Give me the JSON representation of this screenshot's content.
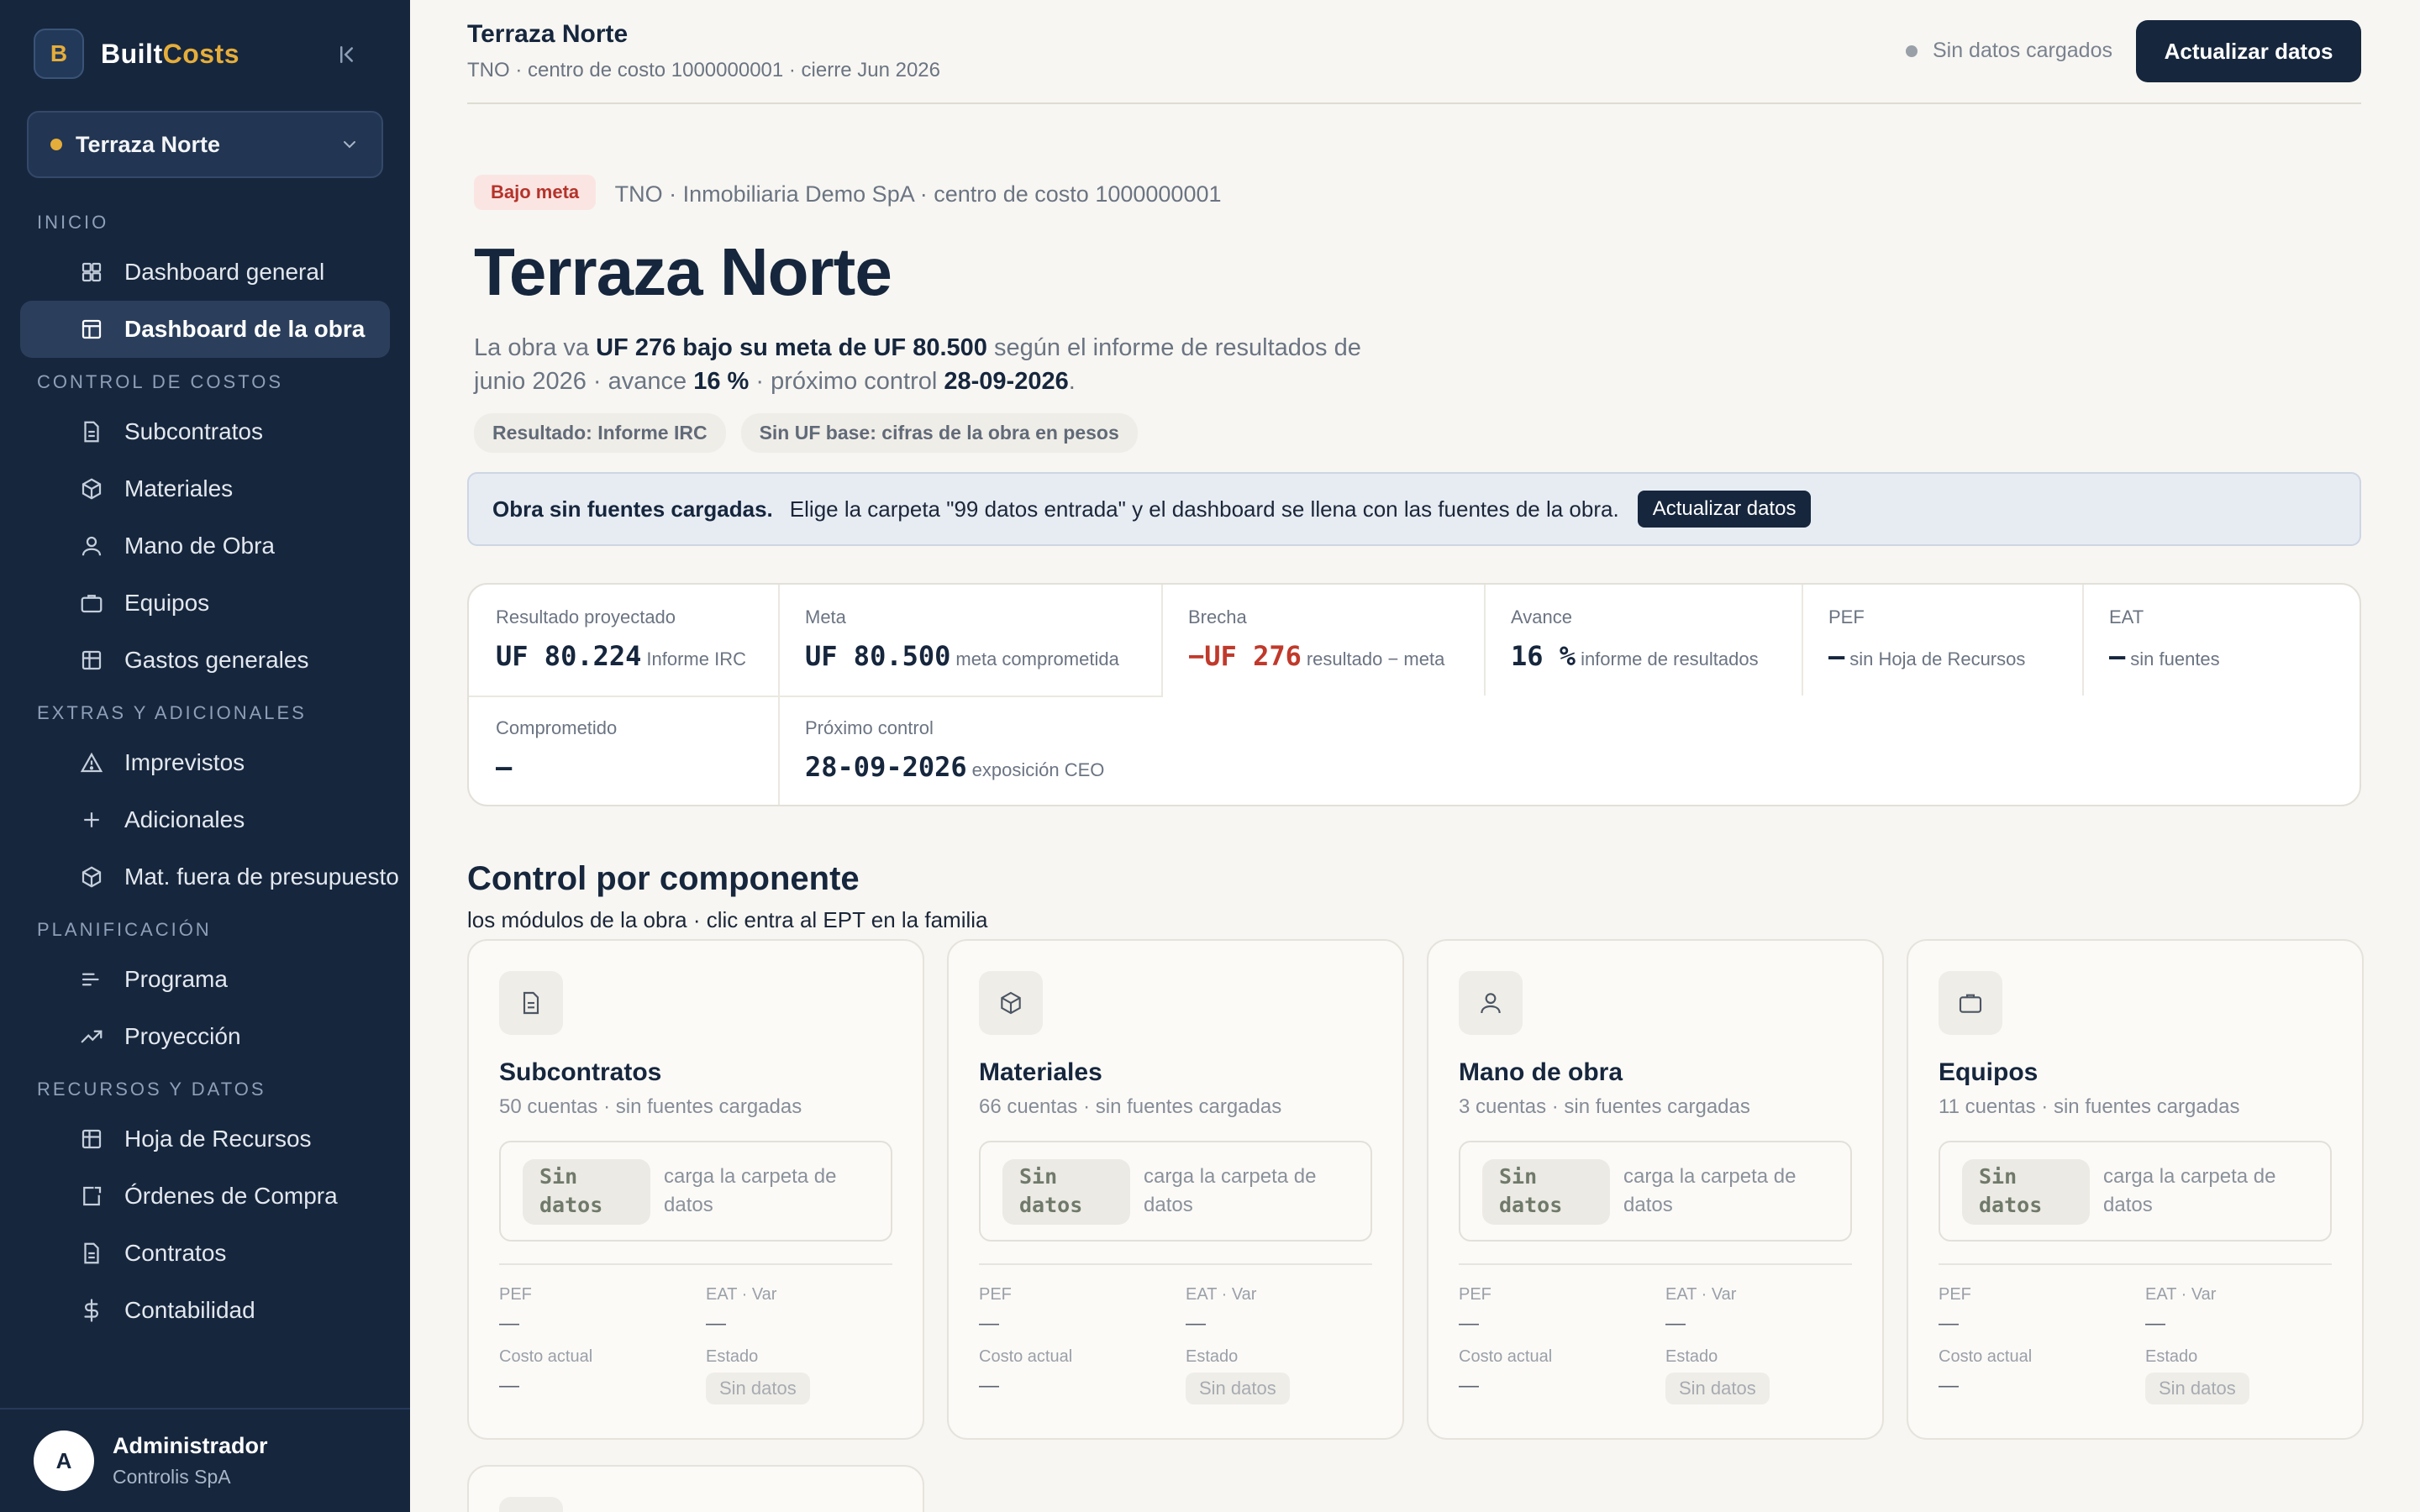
{
  "brand": {
    "logo_letter": "B",
    "name_a": "Built",
    "name_b": "Costs",
    "accent": "#e5ad3a"
  },
  "project_select": {
    "value": "Terraza Norte"
  },
  "nav": {
    "sections": {
      "inicio": "INICIO",
      "control": "CONTROL DE COSTOS",
      "extras": "EXTRAS Y ADICIONALES",
      "plan": "PLANIFICACIÓN",
      "recursos": "RECURSOS Y DATOS"
    },
    "items": {
      "dashboard_general": "Dashboard general",
      "dashboard_obra": "Dashboard de la obra",
      "subcontratos": "Subcontratos",
      "materiales": "Materiales",
      "mano_obra": "Mano de Obra",
      "equipos": "Equipos",
      "gastos": "Gastos generales",
      "imprevistos": "Imprevistos",
      "adicionales": "Adicionales",
      "mat_fuera": "Mat. fuera de presupuesto",
      "programa": "Programa",
      "proyeccion": "Proyección",
      "hoja_recursos": "Hoja de Recursos",
      "ordenes": "Órdenes de Compra",
      "contratos": "Contratos",
      "contabilidad": "Contabilidad"
    }
  },
  "user": {
    "initial": "A",
    "name": "Administrador",
    "org": "Controlis SpA"
  },
  "topbar": {
    "title": "Terraza Norte",
    "subtitle": "TNO · centro de costo 1000000001 · cierre Jun 2026",
    "status": "Sin datos cargados",
    "button": "Actualizar datos"
  },
  "hero": {
    "badge": "Bajo meta",
    "meta": "TNO · Inmobiliaria Demo SpA · centro de costo 1000000001",
    "title": "Terraza Norte",
    "desc": {
      "p1": "La obra va ",
      "b1": "UF 276 bajo su meta de UF 80.500",
      "p2": " según el informe de resultados de junio 2026 · avance ",
      "b2": "16 %",
      "p3": " · próximo control ",
      "b3": "28-09-2026",
      "p4": "."
    },
    "chips": [
      "Resultado: Informe IRC",
      "Sin UF base: cifras de la obra en pesos"
    ]
  },
  "notice": {
    "strong": "Obra sin fuentes cargadas.",
    "msg": "Elige la carpeta \"99 datos entrada\" y el dashboard se llena con las fuentes de la obra.",
    "button": "Actualizar datos"
  },
  "kpis": [
    {
      "label": "Resultado proyectado",
      "value": "UF 80.224",
      "note": "Informe IRC"
    },
    {
      "label": "Meta",
      "value": "UF 80.500",
      "note": "meta comprometida"
    },
    {
      "label": "Brecha",
      "value": "−UF 276",
      "note": "resultado − meta"
    },
    {
      "label": "Avance",
      "value": "16 %",
      "note": "informe de resultados"
    },
    {
      "label": "PEF",
      "value": "—",
      "note": "sin Hoja de Recursos"
    },
    {
      "label": "EAT",
      "value": "—",
      "note": "sin fuentes"
    },
    {
      "label": "Comprometido",
      "value": "—",
      "note": ""
    },
    {
      "label": "Próximo control",
      "value": "28-09-2026",
      "note": "exposición CEO"
    }
  ],
  "section": {
    "title": "Control por componente",
    "subtitle": "los módulos de la obra · clic entra al EPT en la familia"
  },
  "components": [
    {
      "name": "Subcontratos",
      "sub": "50 cuentas · sin fuentes cargadas",
      "icon": "document-icon"
    },
    {
      "name": "Materiales",
      "sub": "66 cuentas · sin fuentes cargadas",
      "icon": "box-icon"
    },
    {
      "name": "Mano de obra",
      "sub": "3 cuentas · sin fuentes cargadas",
      "icon": "person-icon"
    },
    {
      "name": "Equipos",
      "sub": "11 cuentas · sin fuentes cargadas",
      "icon": "briefcase-icon"
    }
  ],
  "component_common": {
    "tag_line1": "Sin",
    "tag_line2": "datos",
    "hint": "carga la carpeta de datos",
    "pef_label": "PEF",
    "eat_label": "EAT · Var",
    "costo_label": "Costo actual",
    "estado_label": "Estado",
    "dash": "—",
    "estado_value": "Sin datos"
  },
  "colors": {
    "sidebar": "#16263d",
    "negative": "#c0392b",
    "badge_bg": "#fbe5e2"
  }
}
